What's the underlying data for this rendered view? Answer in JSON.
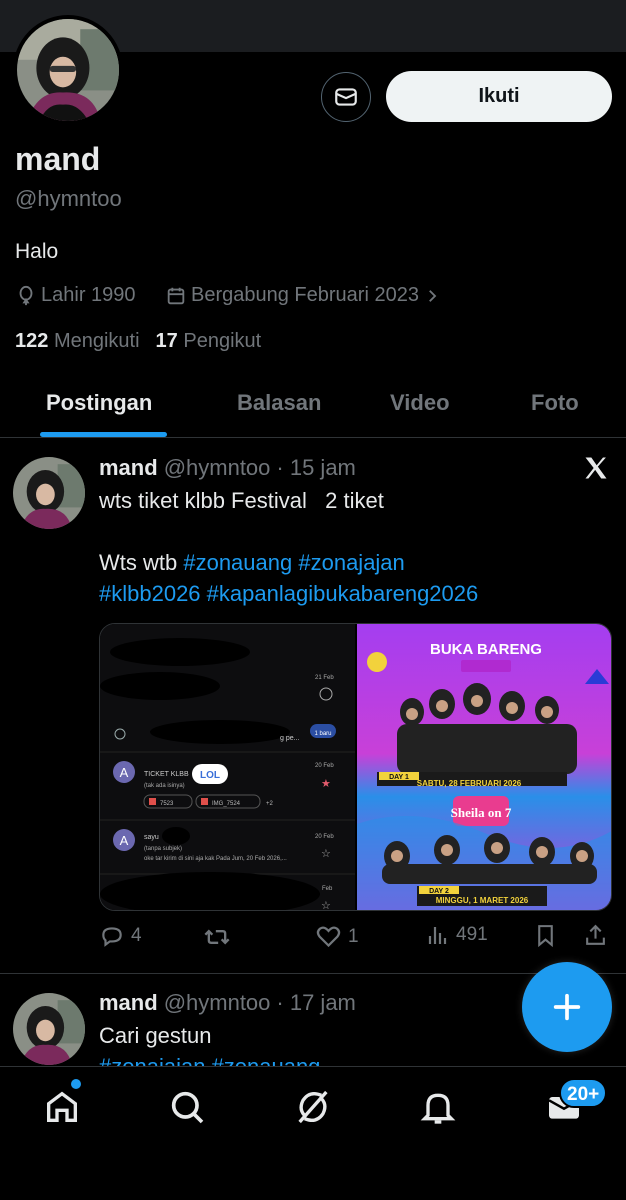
{
  "profile": {
    "name": "mand",
    "handle": "@hymntoo",
    "bio": "Halo",
    "birth": "Lahir 1990",
    "joined": "Bergabung Februari 2023",
    "following_count": "122",
    "following_label": "Mengikuti",
    "followers_count": "17",
    "followers_label": "Pengikut",
    "follow_label": "Ikuti"
  },
  "tabs": [
    {
      "label": "Postingan",
      "active": true
    },
    {
      "label": "Balasan",
      "active": false
    },
    {
      "label": "Video",
      "active": false
    },
    {
      "label": "Foto",
      "active": false
    }
  ],
  "posts": [
    {
      "name": "mand",
      "handle": "@hymntoo",
      "time": "· 15 jam",
      "line1": "wts tiket klbb Festival   2 tiket",
      "line2_prefix": "Wts wtb ",
      "tag1": "#zonauang",
      "tag2": "#zonajajan",
      "tag3": "#klbb2026",
      "tag4": "#kapanlagibukabareng2026",
      "replies": "4",
      "likes": "1",
      "views": "491",
      "media_left": {
        "date1": "21 Feb",
        "new_badge": "1 baru",
        "row_text": "g pe...",
        "item1_title": "TICKET KLBB",
        "item1_sub": "(tak ada isinya)",
        "item1_date": "20 Feb",
        "item1_file1": "7523",
        "item1_file2": "IMG_7524",
        "item1_more": "+2",
        "item2_title": "sayu",
        "item2_sub": "(tanpa subjek)",
        "item2_body": "oke tar kirim di sini aja kak Pada Jum, 20 Feb 2026,...",
        "item2_date": "20 Feb",
        "item3_date": "Feb",
        "sticker": "LOL",
        "avatar_letter": "A"
      },
      "media_right": {
        "brand": "BUKA BARENG",
        "day1": "DAY 1",
        "day1_date": "SABTU, 28 FEBRUARI 2026",
        "day2": "DAY 2",
        "day2_date": "MINGGU, 1 MARET 2026",
        "headliner": "Sheila on 7"
      }
    },
    {
      "name": "mand",
      "handle": "@hymntoo",
      "time": "· 17 jam",
      "line1": "Cari gestun",
      "tags": "#zonajajan #zonauang"
    }
  ],
  "nav": {
    "messages_badge": "20+"
  },
  "colors": {
    "accent": "#1d9bf0",
    "muted": "#71767b",
    "text": "#e7e9ea",
    "divider": "#2f3336"
  },
  "icons": [
    "envelope-icon",
    "balloon-icon",
    "calendar-icon",
    "chevron-right-icon",
    "x-logo-icon",
    "reply-icon",
    "repost-icon",
    "like-icon",
    "views-icon",
    "bookmark-icon",
    "share-icon",
    "plus-icon",
    "home-icon",
    "search-icon",
    "grok-icon",
    "bell-icon",
    "messages-icon"
  ]
}
